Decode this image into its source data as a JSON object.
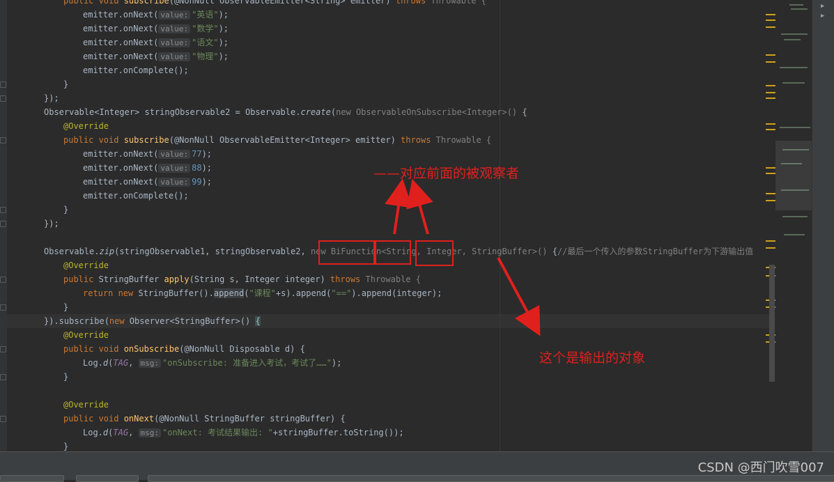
{
  "editor": {
    "lines": {
      "l0a": "public void ",
      "l0b": "subscribe",
      "l0c": "(@NonNull ObservableEmitter<String> emitter) ",
      "l0d": "throws ",
      "l0e": "Throwable {",
      "l1a": "emitter.onNext(",
      "l1h": "value:",
      "l1v": "\"英语\"",
      "l1z": ");",
      "l2v": "\"数学\"",
      "l3v": "\"语文\"",
      "l4v": "\"物理\"",
      "l5": "emitter.onComplete();",
      "l6": "}",
      "l7": "});",
      "l8a": "Observable<Integer> stringObservable2 = Observable.",
      "l8b": "create",
      "l8c": "(",
      "l8d": "new ObservableOnSubscribe<Integer>() ",
      "l8e": "{",
      "override": "@Override",
      "l10c": "(@NonNull ObservableEmitter<Integer> emitter) ",
      "n77": "77",
      "n88": "88",
      "n99": "99",
      "l17a": "Observable.",
      "l17b": "zip",
      "l17c": "(stringObservable1, stringObservable2, ",
      "l17d": "new BiFunction<String, Integer, StringBuffer>() ",
      "l17e": "{",
      "l17f": "//最后一个传入的参数StringBuffer为下游输出值",
      "l19a": "public ",
      "l19b": "StringBuffer ",
      "l19c": "apply",
      "l19d": "(String s, Integer integer) ",
      "l20a": "return new ",
      "l20b": "StringBuffer().",
      "l20c": "append",
      "l20d": "(",
      "l20e": "\"课程\"",
      "l20f": "+s).append(",
      "l20g": "\"==\"",
      "l20h": ").append(integer);",
      "l22a": "}).subscribe(",
      "l22b": "new ",
      "l22c": "Observer<StringBuffer>() ",
      "l24b": "onSubscribe",
      "l24c": "(@NonNull Disposable d) {",
      "log": "Log.",
      "logd": "d",
      "tag": "TAG",
      "msg": "msg:",
      "l25v": "\"onSubscribe: 准备进入考试，考试了……\"",
      "l28b": "onNext",
      "l28c": "(@NonNull StringBuffer stringBuffer) {",
      "l29v": "\"onNext: 考试结果输出: \"",
      "l29z": "+stringBuffer.toString());"
    }
  },
  "annotations": {
    "note1": "——对应前面的被观察者",
    "note2": "这个是输出的对象"
  },
  "watermark": "CSDN @西门吹雪007",
  "colors": {
    "annotation_red": "#e0201d",
    "keyword": "#cc7832",
    "string": "#6a8759",
    "number": "#6897bb",
    "annotation": "#bbb529"
  }
}
